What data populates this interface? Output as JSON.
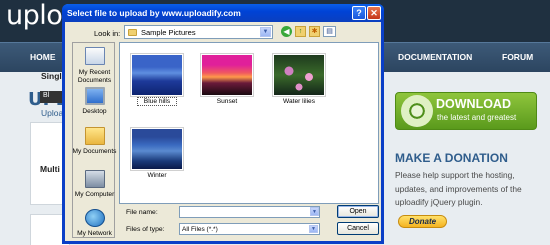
{
  "site": {
    "logo": "uplo",
    "nav": {
      "home": "HOME",
      "documentation": "DOCUMENTATION",
      "forum": "FORUM"
    },
    "page_heading": "UPLO",
    "card_title": "Singl",
    "card_button": "Bl",
    "card_link": "Uploa",
    "multi_title": "Multi",
    "download": {
      "main": "DOWNLOAD",
      "sub": "the latest and greatest"
    },
    "donation": {
      "heading": "MAKE A DONATION",
      "text": "Please help support the hosting, updates, and improvements of the uploadify jQuery plugin.",
      "button": "Donate"
    }
  },
  "dialog": {
    "title": "Select file to upload by www.uploadify.com",
    "help_button": "?",
    "close_button": "✕",
    "look_in_label": "Look in:",
    "look_in_value": "Sample Pictures",
    "places": [
      {
        "label": "My Recent Documents",
        "icon": "recent-documents-icon"
      },
      {
        "label": "Desktop",
        "icon": "desktop-icon"
      },
      {
        "label": "My Documents",
        "icon": "my-documents-icon"
      },
      {
        "label": "My Computer",
        "icon": "my-computer-icon"
      },
      {
        "label": "My Network",
        "icon": "my-network-icon"
      }
    ],
    "files": [
      {
        "name": "Blue hills",
        "selected": true
      },
      {
        "name": "Sunset",
        "selected": false
      },
      {
        "name": "Water lilies",
        "selected": false
      },
      {
        "name": "Winter",
        "selected": false
      }
    ],
    "file_name_label": "File name:",
    "file_name_value": "",
    "file_type_label": "Files of type:",
    "file_type_value": "All Files (*.*)",
    "open_button": "Open",
    "cancel_button": "Cancel"
  }
}
